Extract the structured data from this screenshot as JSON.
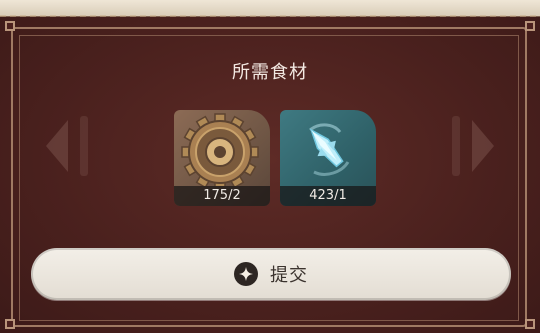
{
  "dialog": {
    "title": "所需食材",
    "ingredients": [
      {
        "icon": "gear-icon",
        "count": "175/2"
      },
      {
        "icon": "crystal-icon",
        "count": "423/1"
      }
    ],
    "submit_label": "提交",
    "submit_icon": "sparkle-icon"
  },
  "colors": {
    "panel": "#4b211e",
    "frame": "#a07a63",
    "button": "#efeae2"
  }
}
